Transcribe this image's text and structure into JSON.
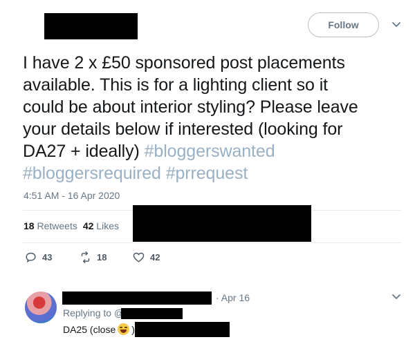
{
  "header": {
    "follow_label": "Follow"
  },
  "tweet": {
    "text_lines": [
      "I have 2 x £50 sponsored post placements",
      "available. This is for a lighting client so it",
      "could be about interior styling? Please leave",
      "your details below if interested (looking for",
      "DA27 + ideally)"
    ],
    "hashtags": [
      "#bloggerswanted",
      "#bloggersrequired",
      "#prrequest"
    ],
    "timestamp": "4:51 AM - 16 Apr 2020",
    "retweets_count": "18",
    "retweets_label": "Retweets",
    "likes_count": "42",
    "likes_label": "Likes"
  },
  "actions": {
    "reply_count": "43",
    "retweet_count": "18",
    "like_count": "42"
  },
  "reply": {
    "time": "· Apr 16",
    "replying_to": "Replying to @",
    "text_before": "DA25 (close",
    "text_after": ")"
  },
  "icons": {
    "caret": "chevron-down-icon",
    "reply": "reply-icon",
    "retweet": "retweet-icon",
    "like": "heart-icon",
    "emoji": "laughing-emoji"
  }
}
